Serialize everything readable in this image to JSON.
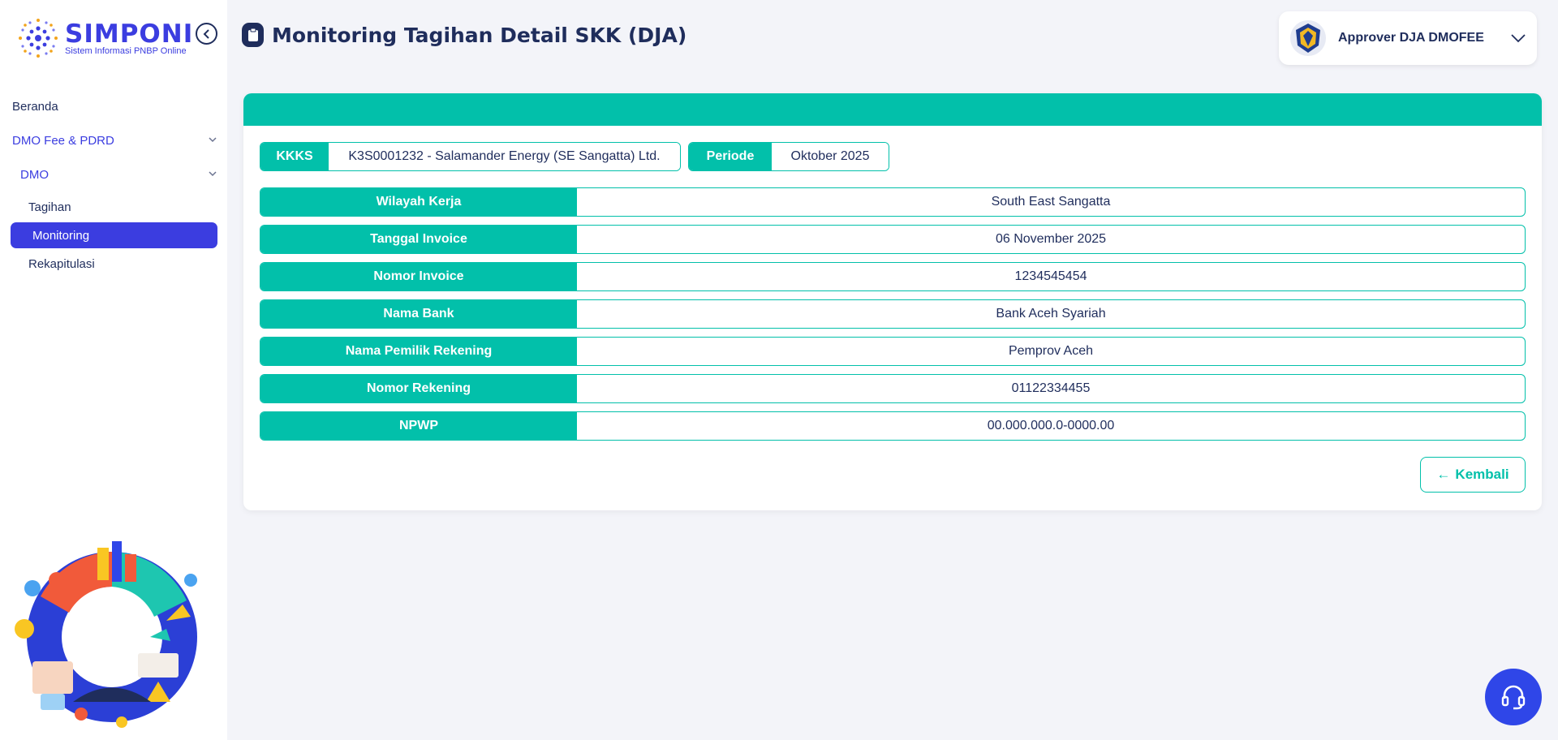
{
  "brand": {
    "title": "SIMPONI",
    "subtitle": "Sistem Informasi PNBP Online",
    "primary_color": "#3b3de0",
    "accent_color": "#02c0aa"
  },
  "sidebar": {
    "items": [
      {
        "label": "Beranda"
      },
      {
        "label": "DMO Fee & PDRD"
      },
      {
        "label": "DMO"
      },
      {
        "label": "Tagihan"
      },
      {
        "label": "Monitoring",
        "active": true
      },
      {
        "label": "Rekapitulasi"
      }
    ]
  },
  "header": {
    "title": "Monitoring Tagihan Detail SKK (DJA)",
    "user": "Approver DJA DMOFEE"
  },
  "summary": {
    "kkks_label": "KKKS",
    "kkks_value": "K3S0001232 - Salamander Energy (SE Sangatta) Ltd.",
    "periode_label": "Periode",
    "periode_value": "Oktober 2025"
  },
  "details": [
    {
      "label": "Wilayah Kerja",
      "value": "South East Sangatta"
    },
    {
      "label": "Tanggal Invoice",
      "value": "06 November 2025"
    },
    {
      "label": "Nomor Invoice",
      "value": "1234545454"
    },
    {
      "label": "Nama Bank",
      "value": "Bank Aceh Syariah"
    },
    {
      "label": "Nama Pemilik Rekening",
      "value": "Pemprov Aceh"
    },
    {
      "label": "Nomor Rekening",
      "value": "01122334455"
    },
    {
      "label": "NPWP",
      "value": "00.000.000.0-0000.00"
    }
  ],
  "actions": {
    "back_label": "Kembali"
  },
  "icons": {
    "collapse": "chevron-left-circle-icon",
    "help": "headset-icon",
    "title": "clipboard-icon"
  }
}
